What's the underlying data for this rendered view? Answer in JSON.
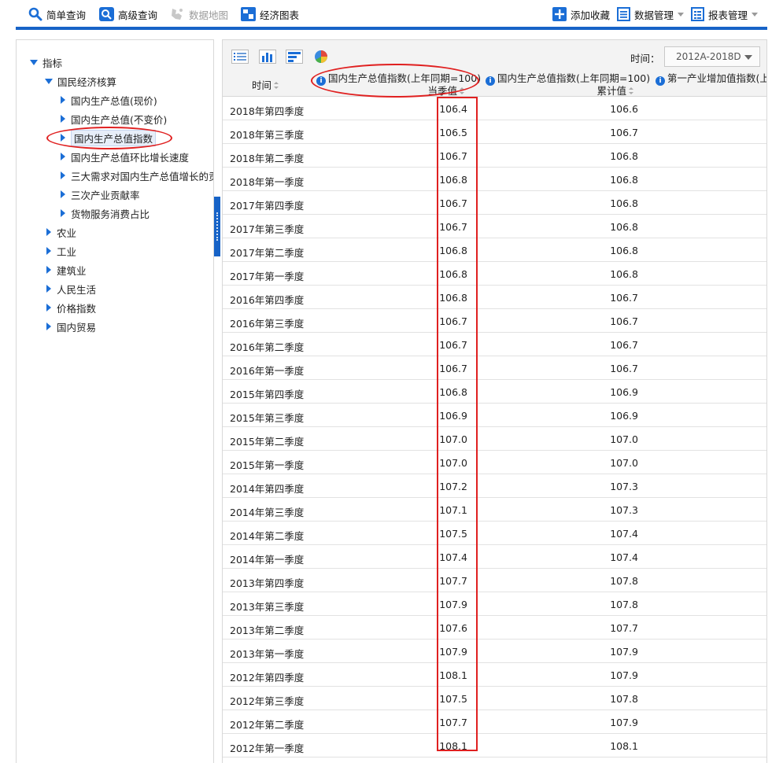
{
  "toolbar": {
    "simple_query": "简单查询",
    "advanced_query": "高级查询",
    "data_map": "数据地图",
    "econ_charts": "经济图表",
    "add_favorite": "添加收藏",
    "data_manage": "数据管理",
    "report_manage": "报表管理"
  },
  "sidebar": {
    "root": "指标",
    "group": "国民经济核算",
    "children": [
      "国内生产总值(现价)",
      "国内生产总值(不变价)",
      "国内生产总值指数",
      "国内生产总值环比增长速度",
      "三大需求对国内生产总值增长的贡献",
      "三次产业贡献率",
      "货物服务消费占比"
    ],
    "selected_index": 2,
    "categories": [
      "农业",
      "工业",
      "建筑业",
      "人民生活",
      "价格指数",
      "国内贸易"
    ]
  },
  "main": {
    "time_label": "时间：",
    "time_range": "2012A-2018D",
    "headers": {
      "time": "时间",
      "col1_line1": "国内生产总值指数(上年同期=100)",
      "col1_line2": "当季值",
      "col2_line1": "国内生产总值指数(上年同期=100)",
      "col2_line2": "累计值",
      "col3_line1": "第一产业增加值指数(上年"
    },
    "rows": [
      [
        "2018年第四季度",
        "106.4",
        "106.6"
      ],
      [
        "2018年第三季度",
        "106.5",
        "106.7"
      ],
      [
        "2018年第二季度",
        "106.7",
        "106.8"
      ],
      [
        "2018年第一季度",
        "106.8",
        "106.8"
      ],
      [
        "2017年第四季度",
        "106.7",
        "106.8"
      ],
      [
        "2017年第三季度",
        "106.7",
        "106.8"
      ],
      [
        "2017年第二季度",
        "106.8",
        "106.8"
      ],
      [
        "2017年第一季度",
        "106.8",
        "106.8"
      ],
      [
        "2016年第四季度",
        "106.8",
        "106.7"
      ],
      [
        "2016年第三季度",
        "106.7",
        "106.7"
      ],
      [
        "2016年第二季度",
        "106.7",
        "106.7"
      ],
      [
        "2016年第一季度",
        "106.7",
        "106.7"
      ],
      [
        "2015年第四季度",
        "106.8",
        "106.9"
      ],
      [
        "2015年第三季度",
        "106.9",
        "106.9"
      ],
      [
        "2015年第二季度",
        "107.0",
        "107.0"
      ],
      [
        "2015年第一季度",
        "107.0",
        "107.0"
      ],
      [
        "2014年第四季度",
        "107.2",
        "107.3"
      ],
      [
        "2014年第三季度",
        "107.1",
        "107.3"
      ],
      [
        "2014年第二季度",
        "107.5",
        "107.4"
      ],
      [
        "2014年第一季度",
        "107.4",
        "107.4"
      ],
      [
        "2013年第四季度",
        "107.7",
        "107.8"
      ],
      [
        "2013年第三季度",
        "107.9",
        "107.8"
      ],
      [
        "2013年第二季度",
        "107.6",
        "107.7"
      ],
      [
        "2013年第一季度",
        "107.9",
        "107.9"
      ],
      [
        "2012年第四季度",
        "108.1",
        "107.9"
      ],
      [
        "2012年第三季度",
        "107.5",
        "107.8"
      ],
      [
        "2012年第二季度",
        "107.7",
        "107.9"
      ],
      [
        "2012年第一季度",
        "108.1",
        "108.1"
      ]
    ]
  },
  "colors": {
    "accent": "#1763c7",
    "annotation": "#e02020"
  }
}
